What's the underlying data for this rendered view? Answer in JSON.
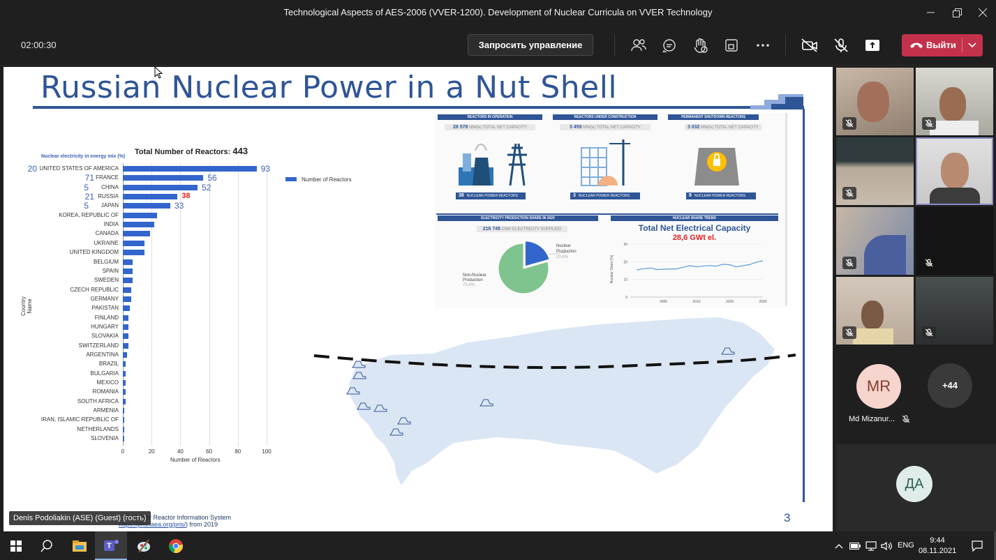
{
  "window": {
    "title": "Technological Aspects of AES-2006 (VVER-1200). Development of Nuclear Curricula on VVER Technology"
  },
  "toolbar": {
    "timer": "02:00:30",
    "request_control_label": "Запросить управление",
    "leave_label": "Выйти",
    "leave_color": "#c4314b"
  },
  "slide": {
    "title": "Russian Nuclear Power in a Nut Shell",
    "page_number": "3",
    "source_text_part1": "S (Power Reactor Information System",
    "source_link": "https://pris.iaea.org/pris/",
    "source_text_part2": ") from 2019",
    "presenter_label": "Denis Podoliakin (ASE) (Guest) (гость)",
    "infographic": {
      "panels": [
        {
          "head": "REACTORS IN OPERATION",
          "capacity": "28 578",
          "capacity_unit": "MW(e) TOTAL NET CAPACITY",
          "count": "38",
          "count_label": "NUCLEAR POWER REACTORS"
        },
        {
          "head": "REACTORS UNDER CONSTRUCTION",
          "capacity": "3 459",
          "capacity_unit": "MW(e) TOTAL NET CAPACITY",
          "count": "3",
          "count_label": "NUCLEAR POWER REACTORS"
        },
        {
          "head": "PERMANENT SHUTDOWN REACTORS",
          "capacity": "3 032",
          "capacity_unit": "MW(e) TOTAL NET CAPACITY",
          "count": "9",
          "count_label": "NUCLEAR POWER REACTORS"
        }
      ],
      "production_head": "ELECTRICITY PRODUCTION SHARE IN 2020",
      "production_value": "216 745",
      "production_unit": "GWh ELECTRICITY SUPPLIED",
      "nuclear_label_1": "Nuclear",
      "nuclear_label_2": "Production",
      "nuclear_pct": "20.6%",
      "nonnuclear_label_1": "Non-Nuclear",
      "nonnuclear_label_2": "Production",
      "nonnuclear_pct": "79.4%",
      "trend_head": "NUCLEAR SHARE TREND",
      "trend_title": "Total Net Electrical Capacity",
      "trend_value": "28,6 GWt el.",
      "trend_ylabel": "Nuclear Share [%]"
    },
    "bar_chart": {
      "subtitle": "Nuclear electricity in energy mix (%)",
      "total_label": "Total Number of Reactors:",
      "total_value": "443",
      "legend": "Number of Reactors",
      "y_axis_title": "Country Name",
      "x_axis_title": "Number of Reactors"
    }
  },
  "chart_data": [
    {
      "type": "bar",
      "orientation": "horizontal",
      "title": "Total Number of Reactors: 443",
      "subtitle": "Nuclear electricity in energy mix (%)",
      "xlabel": "Number of Reactors",
      "ylabel": "Country Name",
      "xlim": [
        0,
        100
      ],
      "xticks": [
        0,
        20,
        40,
        60,
        80,
        100
      ],
      "legend": "Number of Reactors",
      "legend_position": "top-right",
      "grid": true,
      "bar_color": "#3366cc",
      "categories": [
        "UNITED STATES OF AMERICA",
        "FRANCE",
        "CHINA",
        "RUSSIA",
        "JAPAN",
        "KOREA, REPUBLIC OF",
        "INDIA",
        "CANADA",
        "UKRAINE",
        "UNITED KINGDOM",
        "BELGIUM",
        "SPAIN",
        "SWEDEN",
        "CZECH REPUBLIC",
        "GERMANY",
        "PAKISTAN",
        "FINLAND",
        "HUNGARY",
        "SLOVAKIA",
        "SWITZERLAND",
        "ARGENTINA",
        "BRAZIL",
        "BULGARIA",
        "MEXICO",
        "ROMANIA",
        "SOUTH AFRICA",
        "ARMENIA",
        "IRAN, ISLAMIC REPUBLIC OF",
        "NETHERLANDS",
        "SLOVENIA"
      ],
      "values": [
        93,
        56,
        52,
        38,
        33,
        24,
        22,
        19,
        15,
        15,
        7,
        7,
        7,
        6,
        6,
        5,
        4,
        4,
        4,
        4,
        3,
        2,
        2,
        2,
        2,
        2,
        1,
        1,
        1,
        1
      ],
      "labeled_values": [
        {
          "country": "UNITED STATES OF AMERICA",
          "reactors": "93",
          "energy_mix_pct": "20"
        },
        {
          "country": "FRANCE",
          "reactors": "56",
          "energy_mix_pct": "71"
        },
        {
          "country": "CHINA",
          "reactors": "52",
          "energy_mix_pct": "5"
        },
        {
          "country": "RUSSIA",
          "reactors": "38",
          "energy_mix_pct": "21"
        },
        {
          "country": "JAPAN",
          "reactors": "33",
          "energy_mix_pct": "5"
        }
      ],
      "highlight_color": "#e02020"
    },
    {
      "type": "pie",
      "title": "ELECTRICITY PRODUCTION SHARE IN 2020",
      "categories": [
        "Nuclear Production",
        "Non-Nuclear Production"
      ],
      "values": [
        20.6,
        79.4
      ],
      "colors": [
        "#3366cc",
        "#7fc48f"
      ]
    },
    {
      "type": "line",
      "title": "Total Net Electrical Capacity",
      "ylabel": "Nuclear Share [%]",
      "x": [
        2001,
        2002,
        2003,
        2004,
        2005,
        2006,
        2007,
        2008,
        2009,
        2010,
        2011,
        2012,
        2013,
        2014,
        2015,
        2016,
        2017,
        2018,
        2019,
        2020
      ],
      "y": [
        15.4,
        16.0,
        16.5,
        15.6,
        15.8,
        15.9,
        16.0,
        16.9,
        17.8,
        17.1,
        17.6,
        17.8,
        17.5,
        18.6,
        18.3,
        17.1,
        17.8,
        18.4,
        19.7,
        20.6
      ],
      "xticks": [
        2005,
        2010,
        2015,
        2020
      ],
      "ylim": [
        0,
        30
      ],
      "yticks": [
        0,
        10,
        20,
        30
      ]
    }
  ],
  "participants": {
    "mr_initials": "MR",
    "mr_name": "Md Mizanur...",
    "mr_color": "#f6d5cf",
    "more_count": "+44",
    "da_initials": "ДА",
    "da_color": "#dfece9"
  },
  "taskbar": {
    "language": "ENG",
    "time": "9:44",
    "date": "08.11.2021"
  }
}
